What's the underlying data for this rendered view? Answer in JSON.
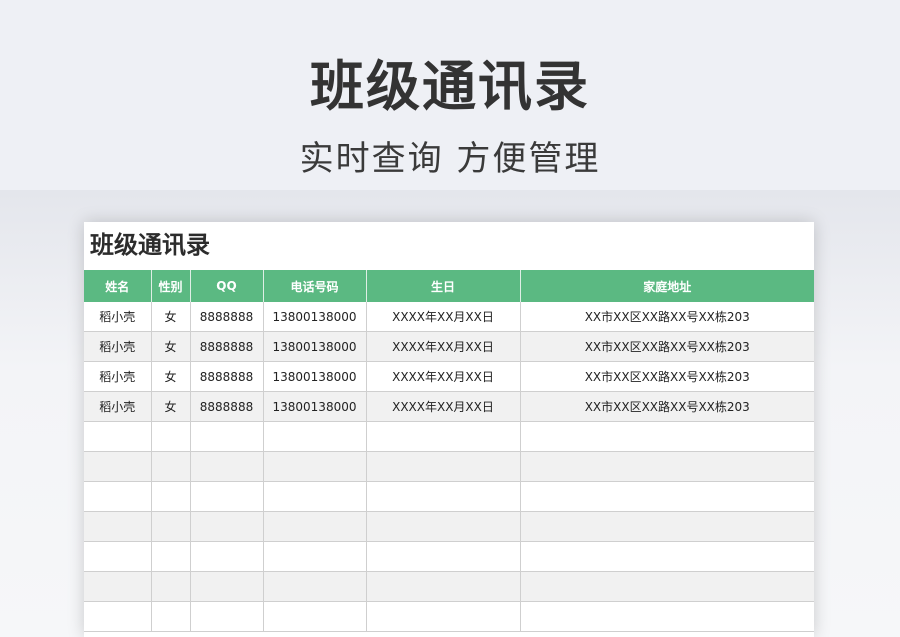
{
  "hero": {
    "title": "班级通讯录",
    "subtitle": "实时查询 方便管理"
  },
  "sheet": {
    "title": "班级通讯录",
    "columns": [
      "姓名",
      "性别",
      "QQ",
      "电话号码",
      "生日",
      "家庭地址"
    ],
    "rows": [
      [
        "稻小壳",
        "女",
        "8888888",
        "13800138000",
        "XXXX年XX月XX日",
        "XX市XX区XX路XX号XX栋203"
      ],
      [
        "稻小壳",
        "女",
        "8888888",
        "13800138000",
        "XXXX年XX月XX日",
        "XX市XX区XX路XX号XX栋203"
      ],
      [
        "稻小壳",
        "女",
        "8888888",
        "13800138000",
        "XXXX年XX月XX日",
        "XX市XX区XX路XX号XX栋203"
      ],
      [
        "稻小壳",
        "女",
        "8888888",
        "13800138000",
        "XXXX年XX月XX日",
        "XX市XX区XX路XX号XX栋203"
      ],
      [
        "",
        "",
        "",
        "",
        "",
        ""
      ],
      [
        "",
        "",
        "",
        "",
        "",
        ""
      ],
      [
        "",
        "",
        "",
        "",
        "",
        ""
      ],
      [
        "",
        "",
        "",
        "",
        "",
        ""
      ],
      [
        "",
        "",
        "",
        "",
        "",
        ""
      ],
      [
        "",
        "",
        "",
        "",
        "",
        ""
      ],
      [
        "",
        "",
        "",
        "",
        "",
        ""
      ]
    ]
  },
  "colors": {
    "header_green": "#5bb982",
    "stripe_gray": "#f1f1f1",
    "background": "#eef0f5"
  }
}
